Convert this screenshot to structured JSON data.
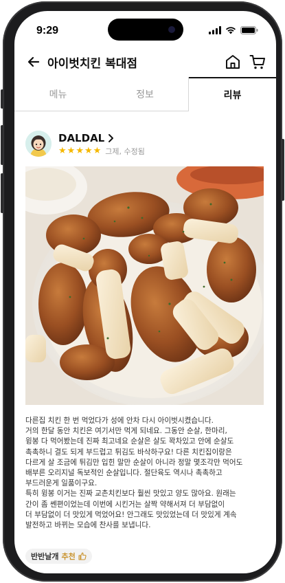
{
  "status_bar": {
    "time": "9:29"
  },
  "header": {
    "title": "아이벗치킨 복대점",
    "back_icon": "arrow-left-icon",
    "home_icon": "home-icon",
    "cart_icon": "cart-icon"
  },
  "tabs": [
    {
      "label": "메뉴",
      "active": false
    },
    {
      "label": "정보",
      "active": false
    },
    {
      "label": "리뷰",
      "active": true
    }
  ],
  "review": {
    "author": "DALDAL",
    "rating": 5,
    "rating_note": "그제, 수정됨",
    "lines": [
      "다른집 치킨 한 번 먹었다가 성에 안차 다시 아이벗시켰습니다.",
      "거의 한달 동안 치킨은 여기서만 먹게 되네요. 그동안 순살, 한마리,",
      "윙봉 다 먹어봤는데 진짜 최고네요 순살은 살도 꽉차있고 안에 순살도",
      "촉촉하니 결도 되게 부드럽고 튀김도 바삭하구요! 다른 치킨집이랑은",
      "다르게 살 조금에 튀김만 입힌 말만 순살이 아니라 정말 몇조각만 먹어도",
      "배부른 오리지널 독보적인 순살입니다. 절단육도 역시나 촉촉하고",
      "부드러운게 일품이구요.",
      "특히 윙봉 이거는 진짜 교촌치킨보다 훨씬 맛있고 양도 많아요. 원래는",
      "간이 좀 쎈편이었는데 이번에 시킨거는 살짝 약해서져 더 부담없이",
      "더 부담없이 더 맛있게 먹었어요! 안그래도 맛있었는데 더 맛있게 계속",
      "발전하고 바뀌는 모습에 찬사를 보냅니다."
    ],
    "menu_tag": "반반날개",
    "recommend_label": "추천"
  },
  "colors": {
    "star": "#f5b800",
    "recommend": "#c9932e",
    "active_tab": "#111111",
    "inactive_tab": "#999999"
  }
}
